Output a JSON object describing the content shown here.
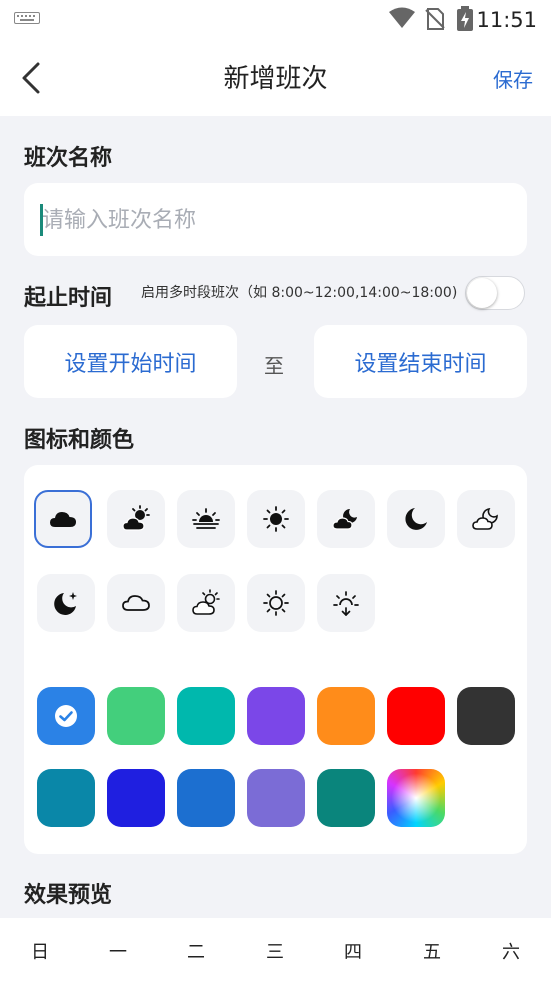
{
  "status": {
    "time": "11:51"
  },
  "header": {
    "title": "新增班次",
    "save_label": "保存"
  },
  "name_section": {
    "label": "班次名称",
    "placeholder": "请输入班次名称",
    "value": ""
  },
  "time_section": {
    "label": "起止时间",
    "multi_hint": "启用多时段班次（如 8:00~12:00,14:00~18:00)",
    "multi_enabled": false,
    "start_label": "设置开始时间",
    "to_label": "至",
    "end_label": "设置结束时间"
  },
  "icon_color_section": {
    "label": "图标和颜色",
    "icons": [
      "cloud-icon",
      "sun-cloud-icon",
      "sunrise-icon",
      "sun-icon",
      "moon-cloud-icon",
      "moon-icon",
      "night-cloud-outline-icon",
      "moon-star-icon",
      "cloud-outline-icon",
      "partly-cloudy-outline-icon",
      "sun-outline-icon",
      "sunset-outline-icon"
    ],
    "selected_icon": "cloud-icon",
    "colors": [
      "#2b82e6",
      "#43cf7c",
      "#00b8ad",
      "#7b47e8",
      "#ff8c1a",
      "#ff0000",
      "#333333",
      "#0a87a8",
      "#1f1fe0",
      "#1c6fd0",
      "#7b6cd6",
      "#0a857c",
      "rainbow"
    ],
    "selected_color": "#2b82e6"
  },
  "preview_section": {
    "label": "效果预览"
  },
  "weekdays": [
    "日",
    "一",
    "二",
    "三",
    "四",
    "五",
    "六"
  ]
}
